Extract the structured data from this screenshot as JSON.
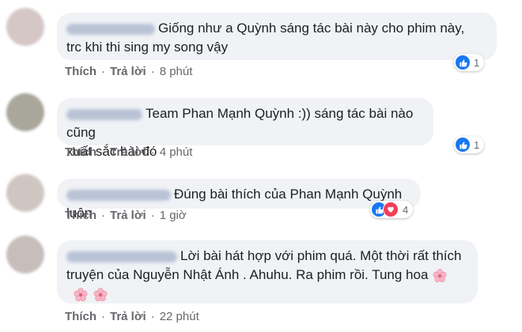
{
  "comments": [
    {
      "text_line1": "Giống như a Quỳnh sáng tác bài này cho phim này,",
      "text_line2": "trc khi thi sing my song vậy",
      "like_action": "Thích",
      "reply_action": "Trả lời",
      "time": "8 phút",
      "reaction_count": "1",
      "reactions": [
        "like-icon"
      ]
    },
    {
      "text_line1": "Team Phan Mạnh Quỳnh :)) sáng tác bài nào cũng",
      "text_line2": "xuất sắc bài đó",
      "like_action": "Thích",
      "reply_action": "Trả lời",
      "time": "4 phút",
      "reaction_count": "1",
      "reactions": [
        "like-icon"
      ]
    },
    {
      "text_line1": "Đúng bài thích của Phan Mạnh Quỳnh luôn",
      "like_action": "Thích",
      "reply_action": "Trả lời",
      "time": "1 giờ",
      "reaction_count": "4",
      "reactions": [
        "like-icon",
        "love-icon"
      ]
    },
    {
      "text_line1": "Lời bài hát hợp với phim quá. Một thời rất thích",
      "text_line2": "truyện của Nguyễn Nhật Ánh . Ahuhu. Ra phim rồi. Tung hoa",
      "like_action": "Thích",
      "reply_action": "Trả lời",
      "time": "22 phút",
      "emoji": [
        "cherry-blossom-icon",
        "cherry-blossom-icon",
        "cherry-blossom-icon"
      ]
    }
  ],
  "colors": {
    "bubble": "#f0f2f5",
    "like_blue": "#1877f2",
    "love_red": "#f33e58",
    "meta_gray": "#65676b"
  }
}
